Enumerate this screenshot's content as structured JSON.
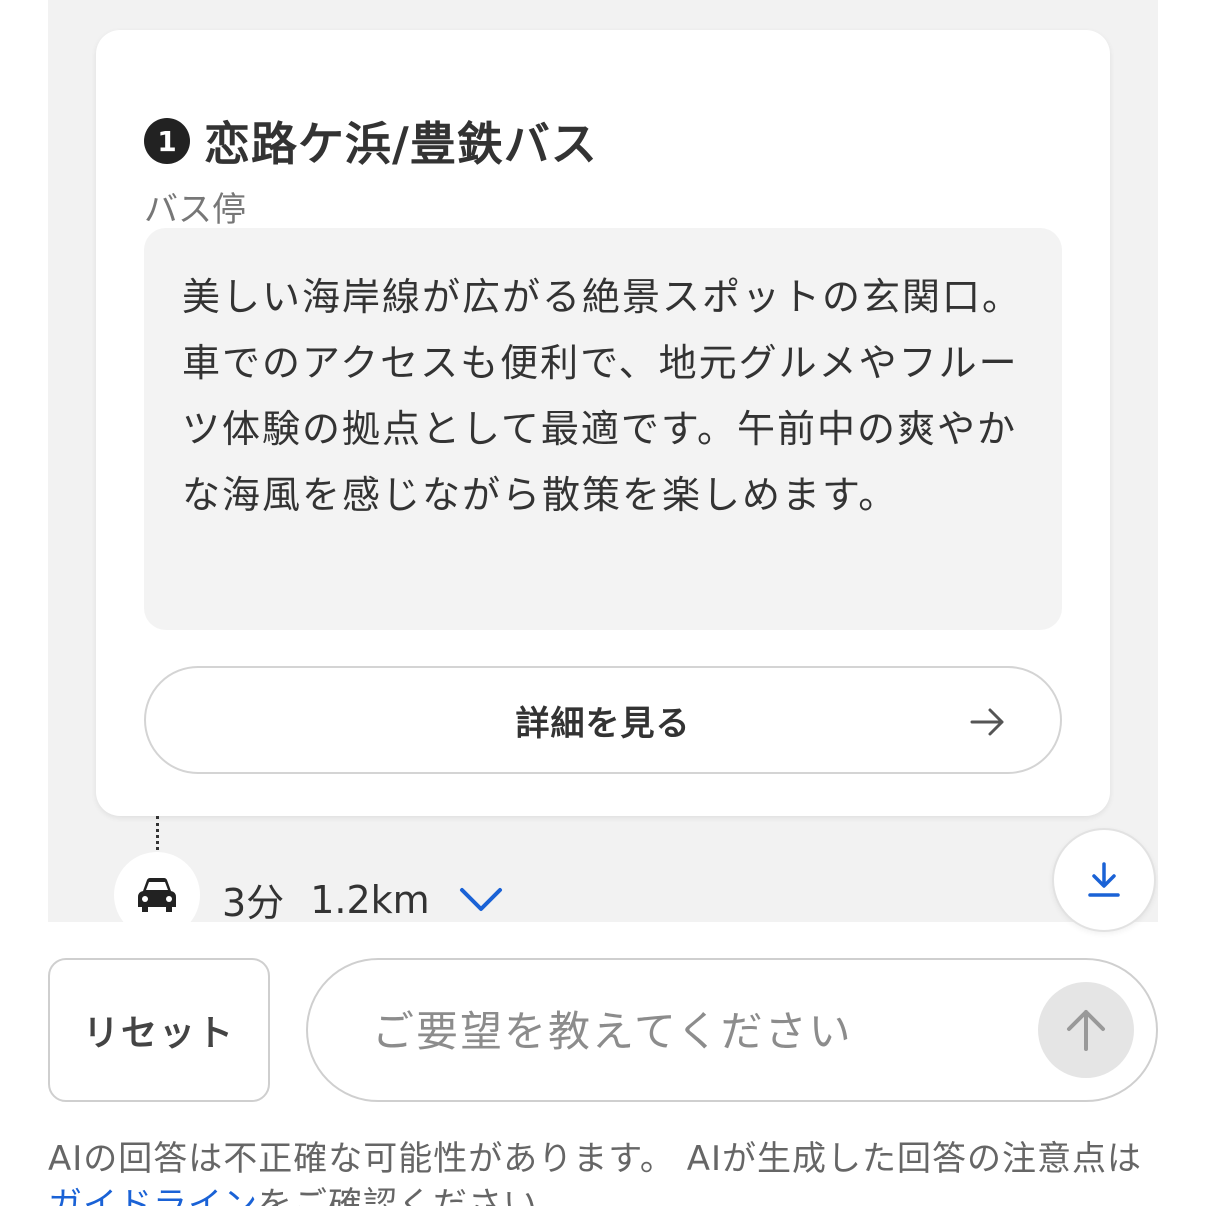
{
  "spot": {
    "number": "1",
    "title": "恋路ケ浜/豊鉄バス",
    "category": "バス停",
    "description": "美しい海岸線が広がる絶景スポットの玄関口。車でのアクセスも便利で、地元グルメやフルーツ体験の拠点として最適です。午前中の爽やかな海風を感じながら散策を楽しめます。",
    "detail_button_label": "詳細を見る"
  },
  "route": {
    "mode_icon": "car-icon",
    "time": "3分",
    "distance": "1.2km"
  },
  "controls": {
    "reset_label": "リセット",
    "input_placeholder": "ご要望を教えてください",
    "input_value": ""
  },
  "disclaimer": {
    "text_before_link": "AIの回答は不正確な可能性があります。 AIが生成した回答の注意点は",
    "link_text": "ガイドライン",
    "text_after_link": "をご確認ください。"
  },
  "colors": {
    "accent": "#1a62d6",
    "background_gray": "#f2f2f2",
    "send_button_inactive": "#e5e5e5"
  }
}
